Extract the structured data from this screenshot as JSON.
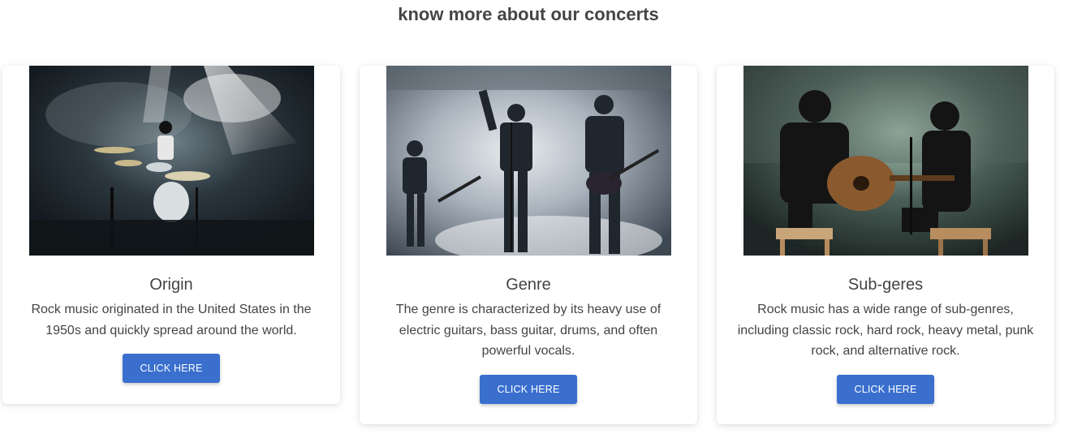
{
  "section": {
    "title": "know more about our concerts"
  },
  "cards": [
    {
      "title": "Origin",
      "text": "Rock music originated in the United States in the 1950s and quickly spread around the world.",
      "button_label": "CLICK HERE",
      "image_subject": "drummer-on-stage-photo"
    },
    {
      "title": "Genre",
      "text": "The genre is characterized by its heavy use of electric guitars, bass guitar, drums, and often powerful vocals.",
      "button_label": "CLICK HERE",
      "image_subject": "rock-band-performing-photo"
    },
    {
      "title": "Sub-geres",
      "text": "Rock music has a wide range of sub-genres, including classic rock, hard rock, heavy metal, punk rock, and alternative rock.",
      "button_label": "CLICK HERE",
      "image_subject": "acoustic-guitarist-concert-photo"
    }
  ],
  "colors": {
    "button": "#3a6fce",
    "title_text": "#454545",
    "body_text": "#444444"
  }
}
